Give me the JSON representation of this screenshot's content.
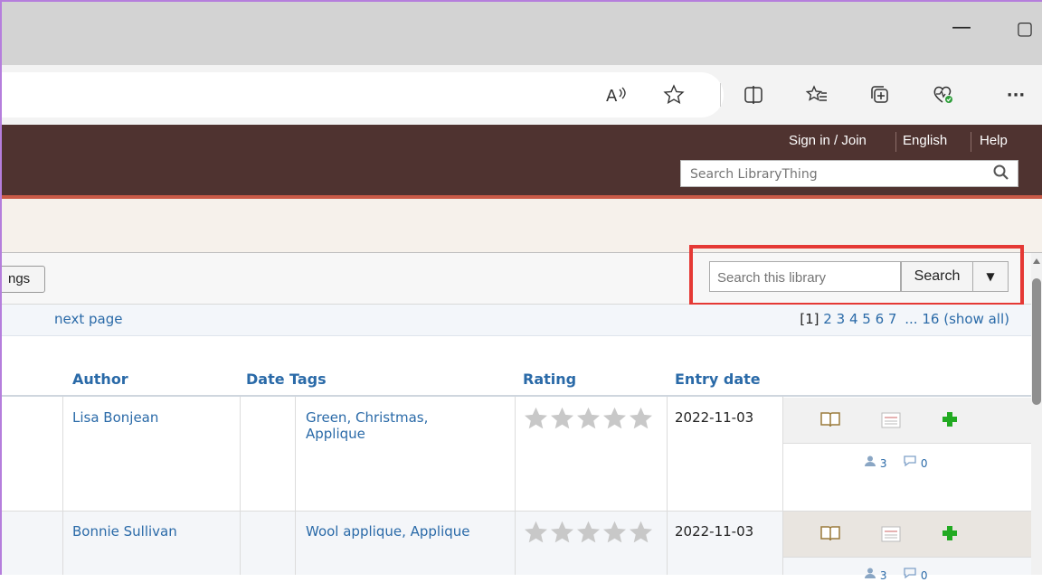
{
  "browser": {
    "window_minimize": "—",
    "window_maximize": "▢",
    "toolbar_icons": [
      "read-aloud-icon",
      "favorite-star-icon",
      "split-screen-icon",
      "favorites-icon",
      "collections-icon",
      "browser-essentials-icon",
      "more-icon"
    ],
    "read_aloud_label": "A",
    "more_label": "···"
  },
  "site_header": {
    "sign_in": "Sign in / Join",
    "language": "English",
    "help": "Help",
    "search_placeholder": "Search LibraryThing"
  },
  "toolbar": {
    "tags_button_label": "ngs",
    "search_placeholder": "Search this library",
    "search_button": "Search",
    "dropdown_arrow": "▼"
  },
  "pager": {
    "next_page": "next page",
    "current": "[1]",
    "pages": [
      "2",
      "3",
      "4",
      "5",
      "6",
      "7"
    ],
    "ellipsis": "...",
    "last": "16",
    "show_all": "(show all)"
  },
  "table": {
    "headers": {
      "author": "Author",
      "date": "Date",
      "tags": "Tags",
      "rating": "Rating",
      "entry_date": "Entry date"
    },
    "rows": [
      {
        "author": "Lisa Bonjean",
        "date": "",
        "tags": [
          "Green",
          "Christmas",
          "Applique"
        ],
        "rating": 0,
        "entry_date": "2022-11-03",
        "members": "3",
        "reviews": "0"
      },
      {
        "author": "Bonnie Sullivan",
        "date": "",
        "tags": [
          "Wool applique",
          "Applique"
        ],
        "rating": 0,
        "entry_date": "2022-11-03",
        "members": "3",
        "reviews": "0"
      }
    ]
  },
  "colors": {
    "header_brown": "#4f3330",
    "accent_red": "#c95a47",
    "link_blue": "#2a6aa8",
    "highlight_red": "#e53935",
    "add_green": "#22aa22",
    "star_gray": "#c8c8c8"
  }
}
